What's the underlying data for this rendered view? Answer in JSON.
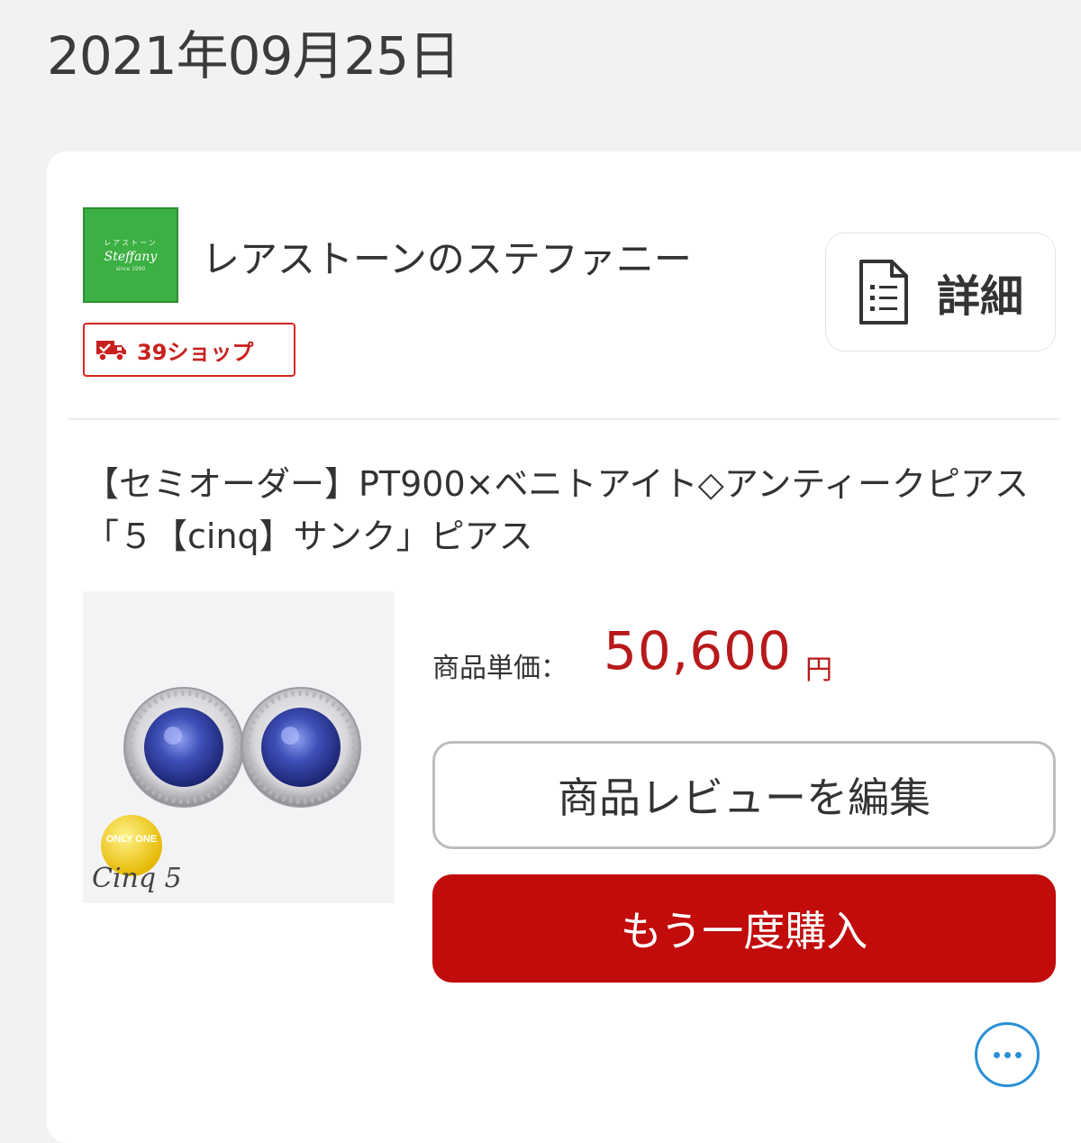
{
  "order_date": "2021年09月25日",
  "shop": {
    "name": "レアストーンのステファニー",
    "logo_text": "Steffany",
    "badge_label": "39ショップ",
    "detail_label": "詳細"
  },
  "product": {
    "title": "【セミオーダー】PT900×ベニトアイト◇アンティークピアス「５【cinq】サンク」ピアス",
    "price_label": "商品単価：",
    "price_value": "50,600",
    "price_unit": "円",
    "image_label_top": "ONLY ONE",
    "image_label_script": "Cinq 5"
  },
  "actions": {
    "review_label": "商品レビューを編集",
    "rebuy_label": "もう一度購入"
  },
  "colors": {
    "accent_red": "#c20b0b",
    "price_red": "#b8191a",
    "badge_red": "#d7261f",
    "logo_green": "#3cb043",
    "more_blue": "#2a8fd6"
  },
  "icons": {
    "badge": "truck-icon",
    "detail": "document-icon",
    "more": "more-dots-icon"
  }
}
